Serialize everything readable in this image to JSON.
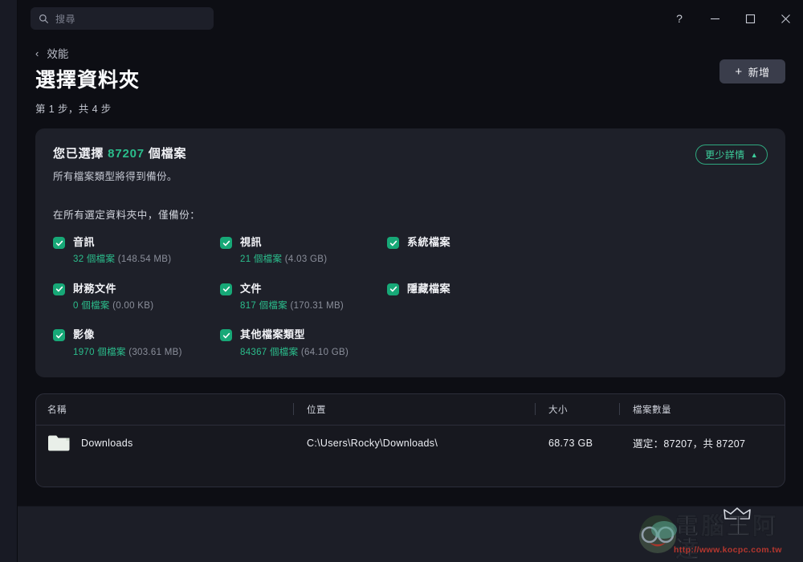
{
  "titlebar": {
    "search": {
      "placeholder": "搜尋",
      "value": "",
      "icon": "search-icon"
    },
    "controls": [
      {
        "name": "help-button",
        "glyph": "?"
      },
      {
        "name": "minimize-button",
        "glyph": "–"
      },
      {
        "name": "maximize-button",
        "glyph": "□"
      },
      {
        "name": "close-button",
        "glyph": "✕"
      }
    ]
  },
  "header": {
    "back_label": "效能",
    "back_icon": "chevron-left-icon",
    "title": "選擇資料夾",
    "step_text": "第 1 步，共 4 步",
    "add_button": {
      "label": "新增",
      "icon": "plus-icon"
    }
  },
  "summary": {
    "title_prefix": "您已選擇 ",
    "count": "87207",
    "title_suffix": " 個檔案",
    "subtitle": "所有檔案類型將得到備份。",
    "details_button": {
      "label": "更少詳情",
      "icon": "chevron-up-icon"
    },
    "filter_label": "在所有選定資料夾中，僅備份：",
    "categories": [
      {
        "name": "音訊",
        "checked": true,
        "files": "32 個檔案",
        "size": "(148.54 MB)"
      },
      {
        "name": "視訊",
        "checked": true,
        "files": "21 個檔案",
        "size": "(4.03 GB)"
      },
      {
        "name": "系統檔案",
        "checked": true,
        "files": "",
        "size": ""
      },
      {
        "name": "財務文件",
        "checked": true,
        "files": "0 個檔案",
        "size": "(0.00 KB)"
      },
      {
        "name": "文件",
        "checked": true,
        "files": "817 個檔案",
        "size": "(170.31 MB)"
      },
      {
        "name": "隱藏檔案",
        "checked": true,
        "files": "",
        "size": ""
      },
      {
        "name": "影像",
        "checked": true,
        "files": "1970 個檔案",
        "size": "(303.61 MB)"
      },
      {
        "name": "其他檔案類型",
        "checked": true,
        "files": "84367 個檔案",
        "size": "(64.10 GB)"
      }
    ]
  },
  "table": {
    "columns": [
      "名稱",
      "位置",
      "大小",
      "檔案數量"
    ],
    "rows": [
      {
        "icon": "folder-icon",
        "name": "Downloads",
        "location": "C:\\Users\\Rocky\\Downloads\\",
        "size": "68.73 GB",
        "count": "選定：87207，共 87207"
      }
    ]
  },
  "watermark": {
    "text": "電腦王阿達",
    "url": "http://www.kocpc.com.tw"
  },
  "colors": {
    "accent_green": "#2bbd8c",
    "checkbox_green": "#17a877",
    "page_bg": "#0d0e14",
    "card_bg": "#1e2029",
    "table_bg": "#17181f"
  }
}
